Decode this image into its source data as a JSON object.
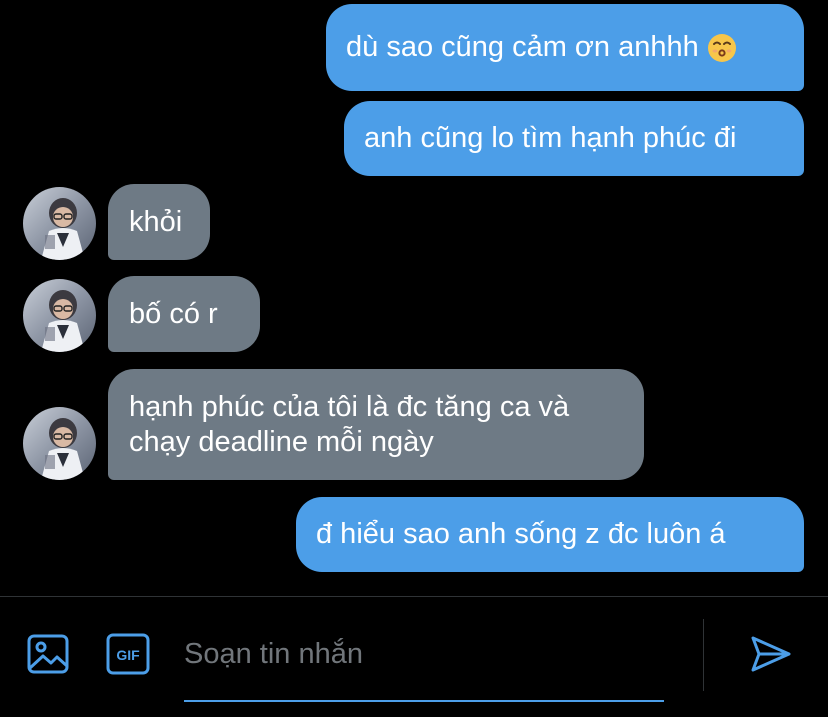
{
  "messages": [
    {
      "direction": "outgoing",
      "text": "dù sao cũng cảm ơn anhhh",
      "emoji": "kissing-face-emoji"
    },
    {
      "direction": "outgoing",
      "text": "anh cũng lo tìm hạnh phúc đi"
    },
    {
      "direction": "incoming",
      "text": "khỏi"
    },
    {
      "direction": "incoming",
      "text": "bố có r"
    },
    {
      "direction": "incoming",
      "line1": "hạnh phúc của tôi là đc tăng ca và",
      "line2": "chạy deadline mỗi ngày"
    },
    {
      "direction": "outgoing",
      "text": "đ hiểu sao anh sống z đc luôn á"
    }
  ],
  "composer": {
    "placeholder": "Soạn tin nhắn",
    "value": "",
    "gif_label": "GIF",
    "icons": {
      "media": "image-icon",
      "gif": "gif-icon",
      "send": "send-icon"
    }
  },
  "colors": {
    "background": "#000000",
    "outgoing_bubble": "#4c9ee8",
    "incoming_bubble": "#6e7a85",
    "accent": "#4c9ee8",
    "placeholder": "#71767b",
    "divider": "#2f3336"
  }
}
